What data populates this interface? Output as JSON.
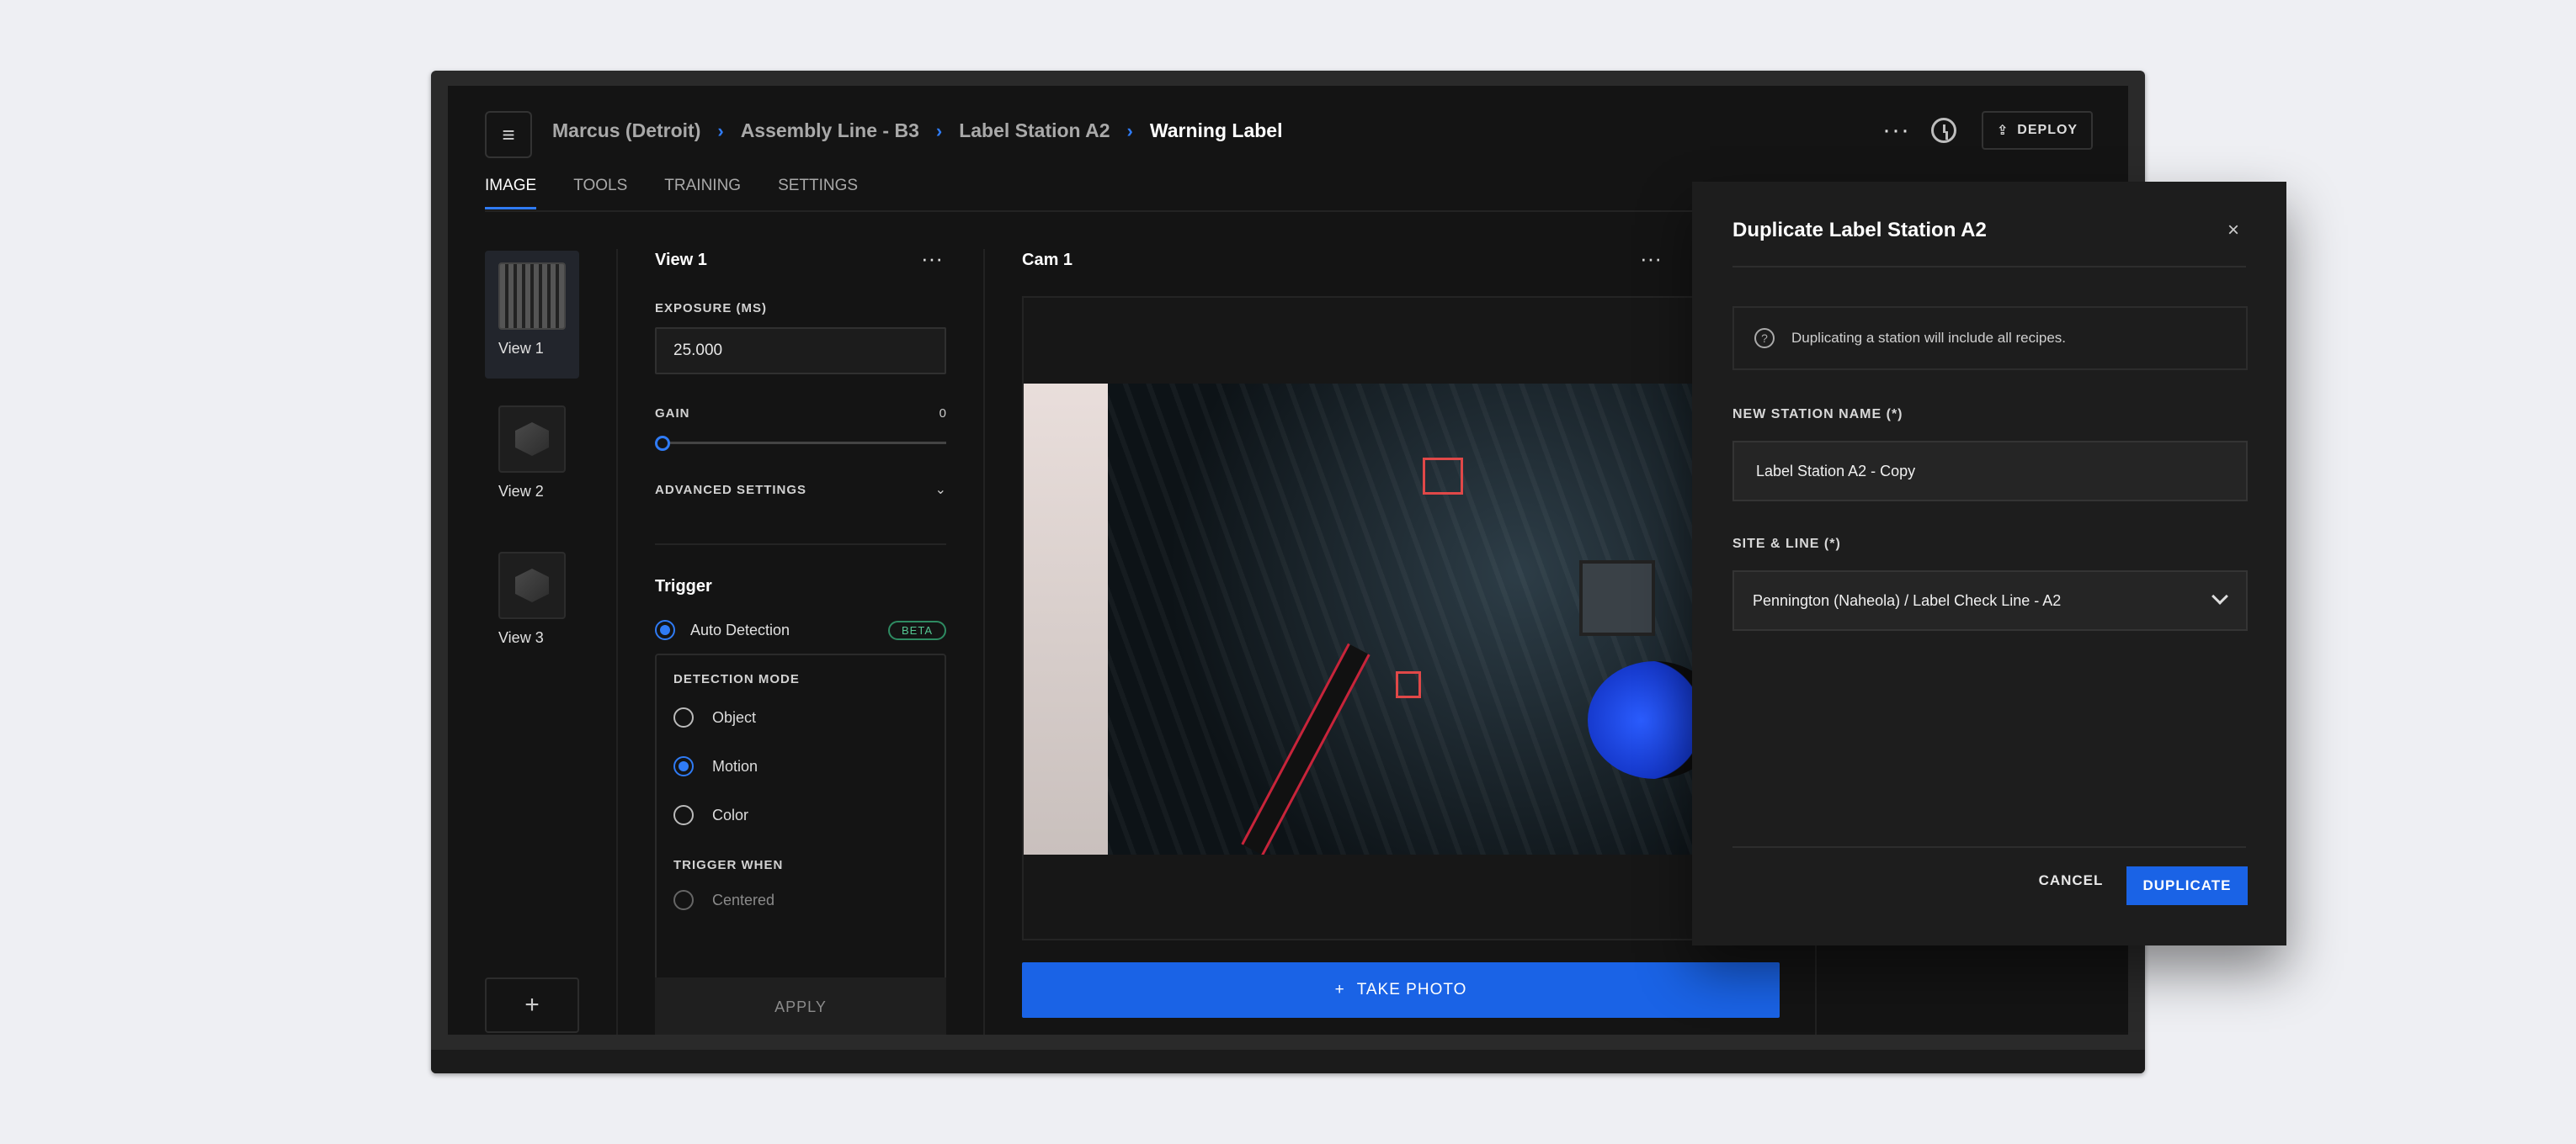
{
  "header": {
    "menu_icon": "hamburger-icon",
    "breadcrumbs": [
      "Marcus (Detroit)",
      "Assembly Line - B3",
      "Label Station A2",
      "Warning Label"
    ],
    "separator": "›",
    "more": "···",
    "deploy_label": "DEPLOY"
  },
  "tabs": [
    "IMAGE",
    "TOOLS",
    "TRAINING",
    "SETTINGS"
  ],
  "views": [
    "View 1",
    "View 2",
    "View 3"
  ],
  "add_view": "+",
  "settings": {
    "title": "View 1",
    "more": "···",
    "exposure_label": "EXPOSURE (MS)",
    "exposure_value": "25.000",
    "gain_label": "GAIN",
    "gain_value": "0",
    "advanced_label": "ADVANCED SETTINGS",
    "trigger_title": "Trigger",
    "auto_detection": "Auto Detection",
    "beta": "BETA",
    "detection_mode_label": "DETECTION MODE",
    "modes": [
      "Object",
      "Motion",
      "Color"
    ],
    "trigger_when_label": "TRIGGER WHEN",
    "trigger_when_option": "Centered",
    "apply": "APPLY"
  },
  "camera": {
    "title": "Cam 1",
    "more": "···",
    "take_photo": "TAKE PHOTO"
  },
  "modal": {
    "title": "Duplicate Label Station A2",
    "close": "×",
    "info": "Duplicating a station will include all recipes.",
    "name_label": "NEW STATION NAME (*)",
    "name_value": "Label Station A2 - Copy",
    "site_label": "SITE & LINE  (*)",
    "site_value": "Pennington (Naheola) / Label Check Line - A2",
    "cancel": "CANCEL",
    "duplicate": "DUPLICATE"
  },
  "colors": {
    "accent": "#1a63e6",
    "beta": "#55c792"
  }
}
